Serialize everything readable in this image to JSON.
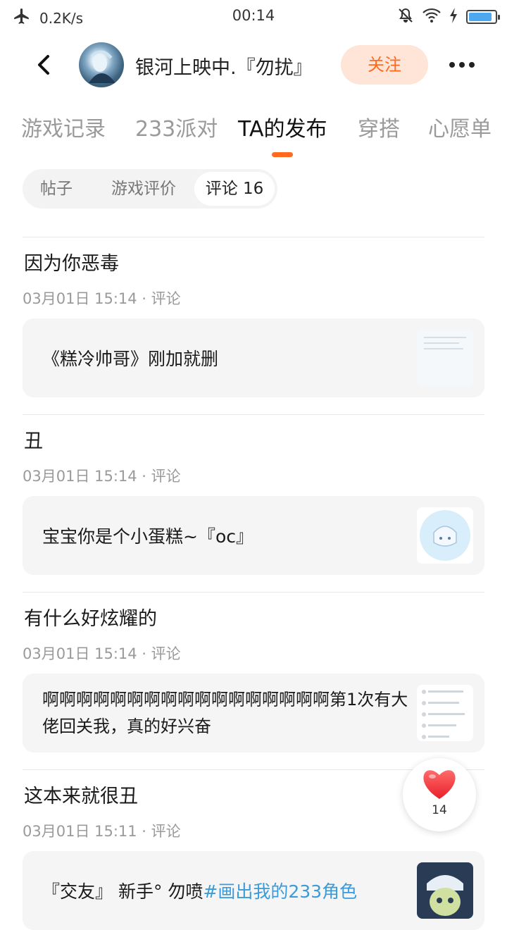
{
  "status_bar": {
    "speed": "0.2K/s",
    "time": "00:14",
    "battery_level": 0.9
  },
  "header": {
    "username": "银河上映中.『勿扰』",
    "follow_label": "关注"
  },
  "tabs": [
    {
      "label": "游戏记录"
    },
    {
      "label": "233派对"
    },
    {
      "label": "TA的发布"
    },
    {
      "label": "穿搭"
    },
    {
      "label": "心愿单"
    }
  ],
  "filters": [
    {
      "label": "帖子"
    },
    {
      "label": "游戏评价"
    },
    {
      "label": "评论 16"
    }
  ],
  "posts": [
    {
      "title": "因为你恶毒",
      "meta": "03月01日  15:14 · 评论",
      "content": "《糕冷帅哥》刚加就删"
    },
    {
      "title": "丑",
      "meta": "03月01日  15:14 · 评论",
      "content": "宝宝你是个小蛋糕~『oc』"
    },
    {
      "title": "有什么好炫耀的",
      "meta": "03月01日  15:14 · 评论",
      "content": "啊啊啊啊啊啊啊啊啊啊啊啊啊啊啊啊啊第1次有大佬回关我，真的好兴奋"
    },
    {
      "title": "这本来就很丑",
      "meta": "03月01日  15:11 · 评论",
      "content": "『交友』 新手° 勿喷",
      "hashtag": "#画出我的233角色"
    }
  ],
  "like": {
    "count": "14"
  },
  "colors": {
    "accent": "#ff6a1f",
    "follow_bg": "#ffe4d8",
    "hashtag": "#3b9bd8"
  }
}
